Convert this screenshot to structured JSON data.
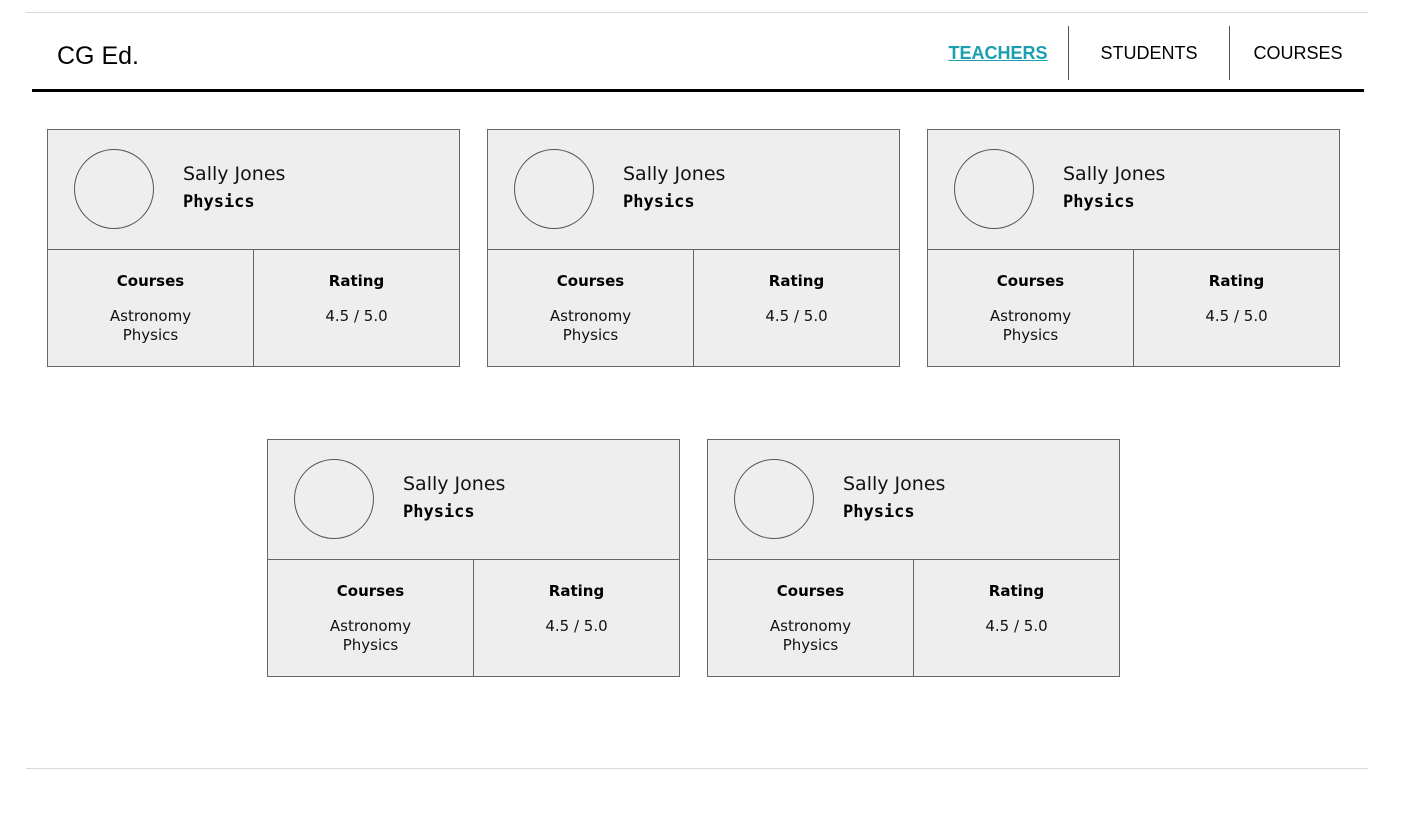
{
  "header": {
    "brand": "CG Ed.",
    "nav": [
      {
        "label": "TEACHERS",
        "active": true
      },
      {
        "label": "STUDENTS",
        "active": false
      },
      {
        "label": "COURSES",
        "active": false
      }
    ]
  },
  "colors": {
    "accent": "#1a9eb0",
    "card_bg": "#eeeeee",
    "border": "#666666"
  },
  "cards": [
    {
      "name": "Sally Jones",
      "subject": "Physics",
      "courses_label": "Courses",
      "courses": [
        "Astronomy",
        "Physics"
      ],
      "rating_label": "Rating",
      "rating": "4.5 / 5.0"
    },
    {
      "name": "Sally Jones",
      "subject": "Physics",
      "courses_label": "Courses",
      "courses": [
        "Astronomy",
        "Physics"
      ],
      "rating_label": "Rating",
      "rating": "4.5 / 5.0"
    },
    {
      "name": "Sally Jones",
      "subject": "Physics",
      "courses_label": "Courses",
      "courses": [
        "Astronomy",
        "Physics"
      ],
      "rating_label": "Rating",
      "rating": "4.5 / 5.0"
    },
    {
      "name": "Sally Jones",
      "subject": "Physics",
      "courses_label": "Courses",
      "courses": [
        "Astronomy",
        "Physics"
      ],
      "rating_label": "Rating",
      "rating": "4.5 / 5.0"
    },
    {
      "name": "Sally Jones",
      "subject": "Physics",
      "courses_label": "Courses",
      "courses": [
        "Astronomy",
        "Physics"
      ],
      "rating_label": "Rating",
      "rating": "4.5 / 5.0"
    }
  ]
}
